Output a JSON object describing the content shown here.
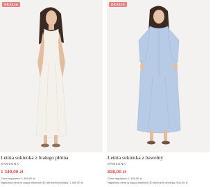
{
  "products": [
    {
      "badge": "OKAZJA",
      "name": "Letnia sukienka z białego płótna",
      "brand": "SAMSUNA",
      "price": "1 349,00 zł",
      "regular_price": "Cena regularna: 1 469,00 zł",
      "lowest_price": "Najniższa cena w ciągu ostatnich 30 dni przed obniżką: 1 469,00 zł",
      "dress_color": "#f4f1ea"
    },
    {
      "badge": "OKAZJA",
      "name": "Letnia sukienka z bawełny",
      "brand": "SAMSUNA",
      "price": "838,00 zł",
      "regular_price": "Cena regularna: 1 169,00 zł",
      "lowest_price": "Najniższa cena w ciągu ostatnich 30 dni przed obniżką: 934,00 zł",
      "dress_color": "#b8cbe6"
    }
  ]
}
